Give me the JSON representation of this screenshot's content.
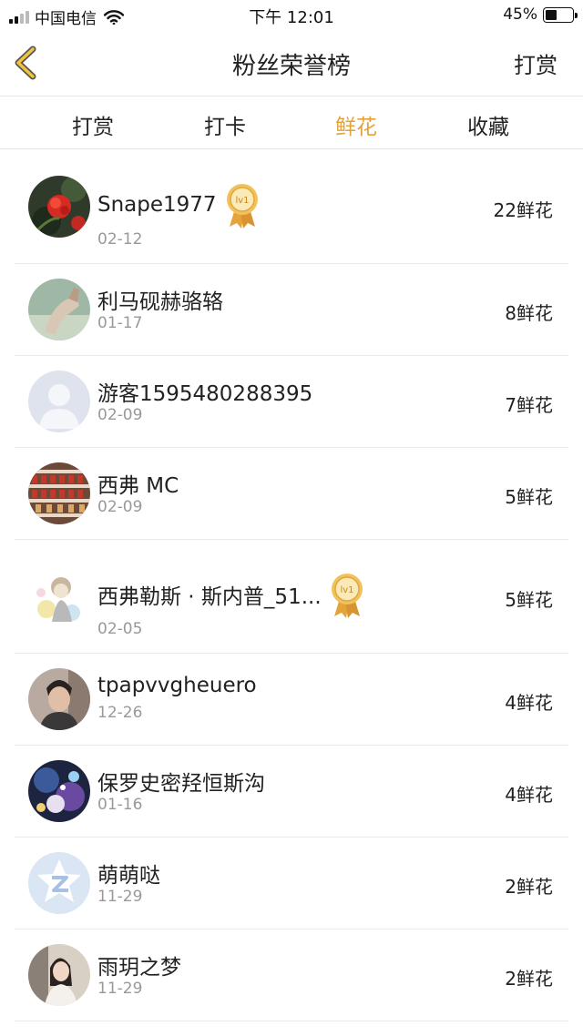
{
  "status_bar": {
    "carrier": "中国电信",
    "time": "下午 12:01",
    "battery": "45%",
    "battery_level": 0.45
  },
  "nav": {
    "title": "粉丝荣誉榜",
    "right_label": "打赏",
    "back_icon": "chevron-left-icon",
    "accent": "#e3a23a"
  },
  "tabs": [
    {
      "label": "打赏",
      "active": false
    },
    {
      "label": "打卡",
      "active": false
    },
    {
      "label": "鲜花",
      "active": true
    },
    {
      "label": "收藏",
      "active": false
    }
  ],
  "fans": [
    {
      "name": "Snape1977",
      "date": "02-12",
      "count": "22鲜花",
      "medal": "lv1",
      "avatar": "red-flower-photo"
    },
    {
      "name": "利马砚赫骆辂",
      "date": "01-17",
      "count": "8鲜花",
      "avatar": "hand-photo"
    },
    {
      "name": "游客1595480288395",
      "date": "02-09",
      "count": "7鲜花",
      "avatar": "default-user-avatar"
    },
    {
      "name": "西弗 MC",
      "date": "02-09",
      "count": "5鲜花",
      "avatar": "shelf-photo"
    },
    {
      "name": "西弗勒斯 · 斯内普_51...",
      "date": "02-05",
      "count": "5鲜花",
      "medal": "lv1",
      "avatar": "anime-drawing"
    },
    {
      "name": "tpapvvgheuero",
      "date": "12-26",
      "count": "4鲜花",
      "avatar": "boy-photo"
    },
    {
      "name": "保罗史密羟恒斯沟",
      "date": "01-16",
      "count": "4鲜花",
      "avatar": "anime-scene"
    },
    {
      "name": "萌萌哒",
      "date": "11-29",
      "count": "2鲜花",
      "avatar": "qzone-logo"
    },
    {
      "name": "雨玥之梦",
      "date": "11-29",
      "count": "2鲜花",
      "avatar": "girl-photo"
    }
  ]
}
